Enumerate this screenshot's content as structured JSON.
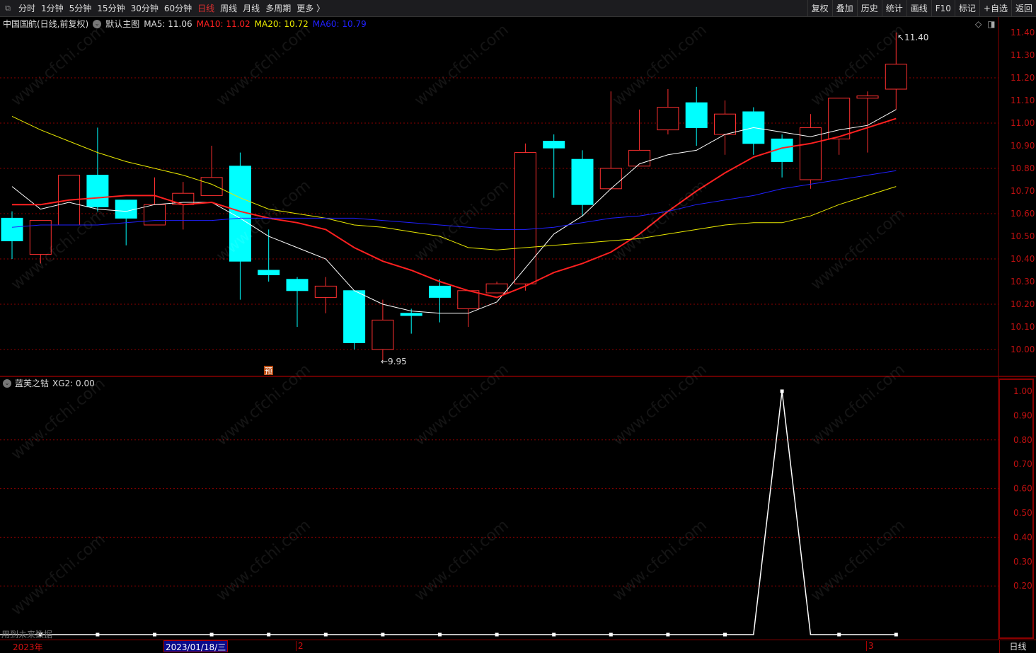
{
  "toolbar": {
    "tabs": [
      "分时",
      "1分钟",
      "5分钟",
      "15分钟",
      "30分钟",
      "60分钟",
      "日线",
      "周线",
      "月线",
      "多周期",
      "更多 〉"
    ],
    "active": "日线",
    "right_buttons": [
      "复权",
      "叠加",
      "历史",
      "统计",
      "画线",
      "F10",
      "标记",
      "+自选",
      "返回"
    ]
  },
  "header": {
    "title": "中国国航(日线,前复权)",
    "template": "默认主图",
    "ma5": "MA5: 11.06",
    "ma10": "MA10: 11.02",
    "ma20": "MA20: 10.72",
    "ma60": "MA60: 10.79"
  },
  "indicator": {
    "name": "蓝芙之钴",
    "value": "XG2: 0.00",
    "note": "用到未来数据"
  },
  "annotations": {
    "high": "11.40",
    "low": "←9.95",
    "badge": "预"
  },
  "bottom": {
    "year": "2023年",
    "date": "2023/01/18/三",
    "m2": "2",
    "m3": "3",
    "period": "日线"
  },
  "watermark": "www.cfchi.com",
  "colors": {
    "up": "#ff3030",
    "down": "#00ffff",
    "ma5": "#ffffff",
    "ma10": "#ff2020",
    "ma20": "#e8e800",
    "ma60": "#2020ff",
    "grid": "#8b0000"
  },
  "chart_data": [
    {
      "type": "candlestick",
      "ylim": [
        9.9,
        11.45
      ],
      "yticks": [
        "11.40",
        "11.30",
        "11.20",
        "11.10",
        "11.00",
        "10.90",
        "10.80",
        "10.70",
        "10.60",
        "10.50",
        "10.40",
        "10.30",
        "10.20",
        "10.10",
        "10.00"
      ],
      "ohlc": [
        [
          10.58,
          10.61,
          10.4,
          10.48
        ],
        [
          10.42,
          10.57,
          10.38,
          10.57
        ],
        [
          10.55,
          10.77,
          10.55,
          10.77
        ],
        [
          10.77,
          10.98,
          10.61,
          10.63
        ],
        [
          10.66,
          10.66,
          10.46,
          10.58
        ],
        [
          10.55,
          10.76,
          10.55,
          10.64
        ],
        [
          10.64,
          10.74,
          10.53,
          10.69
        ],
        [
          10.68,
          10.9,
          10.68,
          10.76
        ],
        [
          10.81,
          10.87,
          10.22,
          10.39
        ],
        [
          10.35,
          10.53,
          10.3,
          10.33
        ],
        [
          10.31,
          10.32,
          10.1,
          10.26
        ],
        [
          10.23,
          10.32,
          10.16,
          10.28
        ],
        [
          10.26,
          10.26,
          10.0,
          10.03
        ],
        [
          10.0,
          10.22,
          9.95,
          10.13
        ],
        [
          10.16,
          10.18,
          10.07,
          10.15
        ],
        [
          10.28,
          10.31,
          10.12,
          10.23
        ],
        [
          10.18,
          10.26,
          10.1,
          10.26
        ],
        [
          10.25,
          10.3,
          10.25,
          10.29
        ],
        [
          10.29,
          10.91,
          10.26,
          10.87
        ],
        [
          10.92,
          10.95,
          10.67,
          10.89
        ],
        [
          10.84,
          10.88,
          10.59,
          10.64
        ],
        [
          10.71,
          11.14,
          10.71,
          10.8
        ],
        [
          10.81,
          11.06,
          10.81,
          10.88
        ],
        [
          10.97,
          11.15,
          10.95,
          11.07
        ],
        [
          11.09,
          11.16,
          10.9,
          10.98
        ],
        [
          10.95,
          11.1,
          10.86,
          11.04
        ],
        [
          11.05,
          11.07,
          10.86,
          10.91
        ],
        [
          10.93,
          10.95,
          10.76,
          10.83
        ],
        [
          10.75,
          11.04,
          10.71,
          10.98
        ],
        [
          10.93,
          11.11,
          10.86,
          11.11
        ],
        [
          11.11,
          11.14,
          10.87,
          11.12
        ],
        [
          11.15,
          11.4,
          11.06,
          11.26
        ]
      ],
      "series": [
        {
          "name": "MA5",
          "values": [
            10.72,
            10.62,
            10.65,
            10.62,
            10.61,
            10.64,
            10.65,
            10.65,
            10.58,
            10.5,
            10.45,
            10.4,
            10.26,
            10.2,
            10.17,
            10.16,
            10.16,
            10.21,
            10.36,
            10.51,
            10.59,
            10.71,
            10.82,
            10.86,
            10.88,
            10.95,
            10.98,
            10.96,
            10.94,
            10.97,
            10.99,
            11.06
          ]
        },
        {
          "name": "MA10",
          "values": [
            10.64,
            10.64,
            10.66,
            10.67,
            10.68,
            10.68,
            10.64,
            10.65,
            10.61,
            10.58,
            10.56,
            10.53,
            10.45,
            10.39,
            10.35,
            10.3,
            10.26,
            10.23,
            10.28,
            10.34,
            10.38,
            10.43,
            10.51,
            10.61,
            10.7,
            10.78,
            10.85,
            10.89,
            10.91,
            10.94,
            10.98,
            11.02
          ]
        },
        {
          "name": "MA20",
          "values": [
            11.03,
            10.97,
            10.92,
            10.87,
            10.83,
            10.8,
            10.77,
            10.73,
            10.67,
            10.62,
            10.6,
            10.58,
            10.55,
            10.54,
            10.52,
            10.5,
            10.45,
            10.44,
            10.45,
            10.46,
            10.47,
            10.48,
            10.49,
            10.51,
            10.53,
            10.55,
            10.56,
            10.56,
            10.59,
            10.64,
            10.68,
            10.72
          ]
        },
        {
          "name": "MA60",
          "values": [
            10.54,
            10.55,
            10.55,
            10.55,
            10.56,
            10.57,
            10.57,
            10.57,
            10.58,
            10.58,
            10.58,
            10.58,
            10.58,
            10.57,
            10.56,
            10.55,
            10.54,
            10.53,
            10.53,
            10.54,
            10.56,
            10.58,
            10.59,
            10.61,
            10.64,
            10.66,
            10.68,
            10.71,
            10.73,
            10.75,
            10.77,
            10.79
          ]
        }
      ]
    },
    {
      "type": "line",
      "title": "XG2",
      "ylim": [
        0,
        1.0
      ],
      "yticks": [
        "1.00",
        "0.90",
        "0.80",
        "0.70",
        "0.60",
        "0.50",
        "0.40",
        "0.30",
        "0.20"
      ],
      "values": [
        0,
        0,
        0,
        0,
        0,
        0,
        0,
        0,
        0,
        0,
        0,
        0,
        0,
        0,
        0,
        0,
        0,
        0,
        0,
        0,
        0,
        0,
        0,
        0,
        0,
        0,
        0,
        1,
        0,
        0,
        0,
        0
      ]
    }
  ]
}
